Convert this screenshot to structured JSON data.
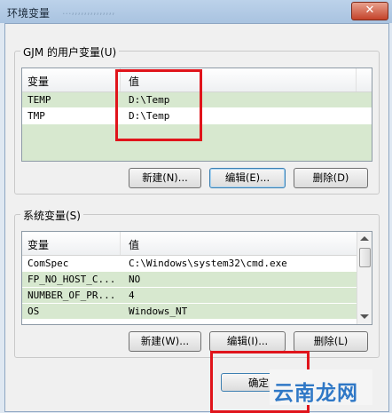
{
  "window": {
    "title": "环境变量",
    "ghost_text": "...,,,,,,,,,,,,,,",
    "close_glyph": "✕"
  },
  "user_vars": {
    "group_label": "GJM 的用户变量(U)",
    "col_name": "变量",
    "col_value": "值",
    "rows": [
      {
        "name": "TEMP",
        "value": "D:\\Temp"
      },
      {
        "name": "TMP",
        "value": "D:\\Temp"
      }
    ],
    "buttons": {
      "new": "新建(N)...",
      "edit": "编辑(E)...",
      "delete": "删除(D)"
    }
  },
  "system_vars": {
    "group_label": "系统变量(S)",
    "col_name": "变量",
    "col_value": "值",
    "rows": [
      {
        "name": "ComSpec",
        "value": "C:\\Windows\\system32\\cmd.exe"
      },
      {
        "name": "FP_NO_HOST_C...",
        "value": "NO"
      },
      {
        "name": "NUMBER_OF_PR...",
        "value": "4"
      },
      {
        "name": "OS",
        "value": "Windows_NT"
      }
    ],
    "buttons": {
      "new": "新建(W)...",
      "edit": "编辑(I)...",
      "delete": "删除(L)"
    }
  },
  "footer": {
    "ok": "确定"
  },
  "watermark": {
    "text": "云南龙网"
  },
  "colors": {
    "selection": "#d7e8cf",
    "highlight_box": "#e0141b",
    "watermark": "#2f78c6"
  }
}
